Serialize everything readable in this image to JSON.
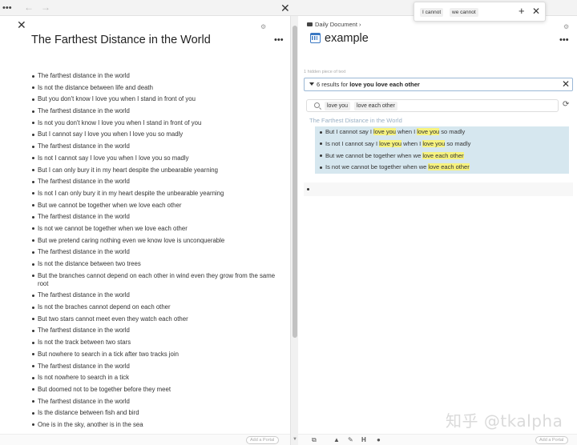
{
  "topbar": {
    "more_label": "•••",
    "back_icon": "arrow-left-icon",
    "forward_icon": "arrow-right-icon",
    "back_glyph": "←",
    "forward_glyph": "→",
    "close_glyph": "✕"
  },
  "find_popover": {
    "term1": "I cannot",
    "term2": "we cannot",
    "add_glyph": "+",
    "close_glyph": "✕"
  },
  "left": {
    "close_glyph": "✕",
    "gear_glyph": "⚙",
    "title": "The Farthest Distance in the World",
    "more_label": "•••",
    "lines": [
      "The farthest distance in the world",
      "Is not the distance between life and death",
      "But you don't know I love you when I stand in front of you",
      "The farthest distance in the world",
      "Is not you don't know I love you when I stand in front of you",
      "But I cannot say I love you when I love you so madly",
      "The farthest distance in the world",
      "Is not I cannot say I love you when I love you so madly",
      "But I can only bury it in my heart despite the unbearable yearning",
      "The farthest distance in the world",
      "Is not I can only bury it in my heart despite the unbearable yearning",
      "But we cannot be together when we love each other",
      "The farthest distance in the world",
      "Is not we cannot be together when we love each other",
      "But we pretend caring nothing even we know love is unconquerable",
      "The farthest distance in the world",
      "Is not the distance between two trees",
      "But the branches cannot depend on each other in wind even they grow from the same root",
      "The farthest distance in the world",
      "Is not the braches cannot depend on each other",
      "But two stars cannot meet even they watch each other",
      "The farthest distance in the world",
      "Is not the track between two stars",
      "But nowhere to search in a tick after two tracks join",
      "The farthest distance in the world",
      "Is not nowhere to search in a tick",
      "But doomed not to be together before they meet",
      "The farthest distance in the world",
      "Is the distance between fish and bird",
      "One is in the sky, another is in the sea"
    ],
    "portal_placeholder": "Add a Portal"
  },
  "right": {
    "breadcrumb": "Daily Document",
    "breadcrumb_sep": "›",
    "gear_glyph": "⚙",
    "title": "example",
    "more_label": "•••",
    "hidden_note": "1 hidden piece of text",
    "results_prefix": "6 results for ",
    "results_query": "love you love each other",
    "results_close": "✕",
    "search_tag1": "love you",
    "search_tag2": "love each other",
    "refresh_glyph": "⟳",
    "group_title": "The Farthest Distance in the World",
    "results": [
      {
        "a": "But I cannot say I ",
        "h1": "love you",
        "b": " when I ",
        "h2": "love you",
        "c": " so madly"
      },
      {
        "a": "Is not I cannot say I ",
        "h1": "love you",
        "b": " when I ",
        "h2": "love you",
        "c": " so madly"
      },
      {
        "a": "But we cannot be together when we ",
        "h1": "love each other",
        "b": "",
        "h2": "",
        "c": ""
      },
      {
        "a": "Is not we cannot be together when we ",
        "h1": "love each other",
        "b": "",
        "h2": "",
        "c": ""
      }
    ],
    "toolbar": {
      "heading_glyph": "H",
      "portal_placeholder": "Add a Portal"
    }
  },
  "watermark": "知乎 @tkalpha"
}
